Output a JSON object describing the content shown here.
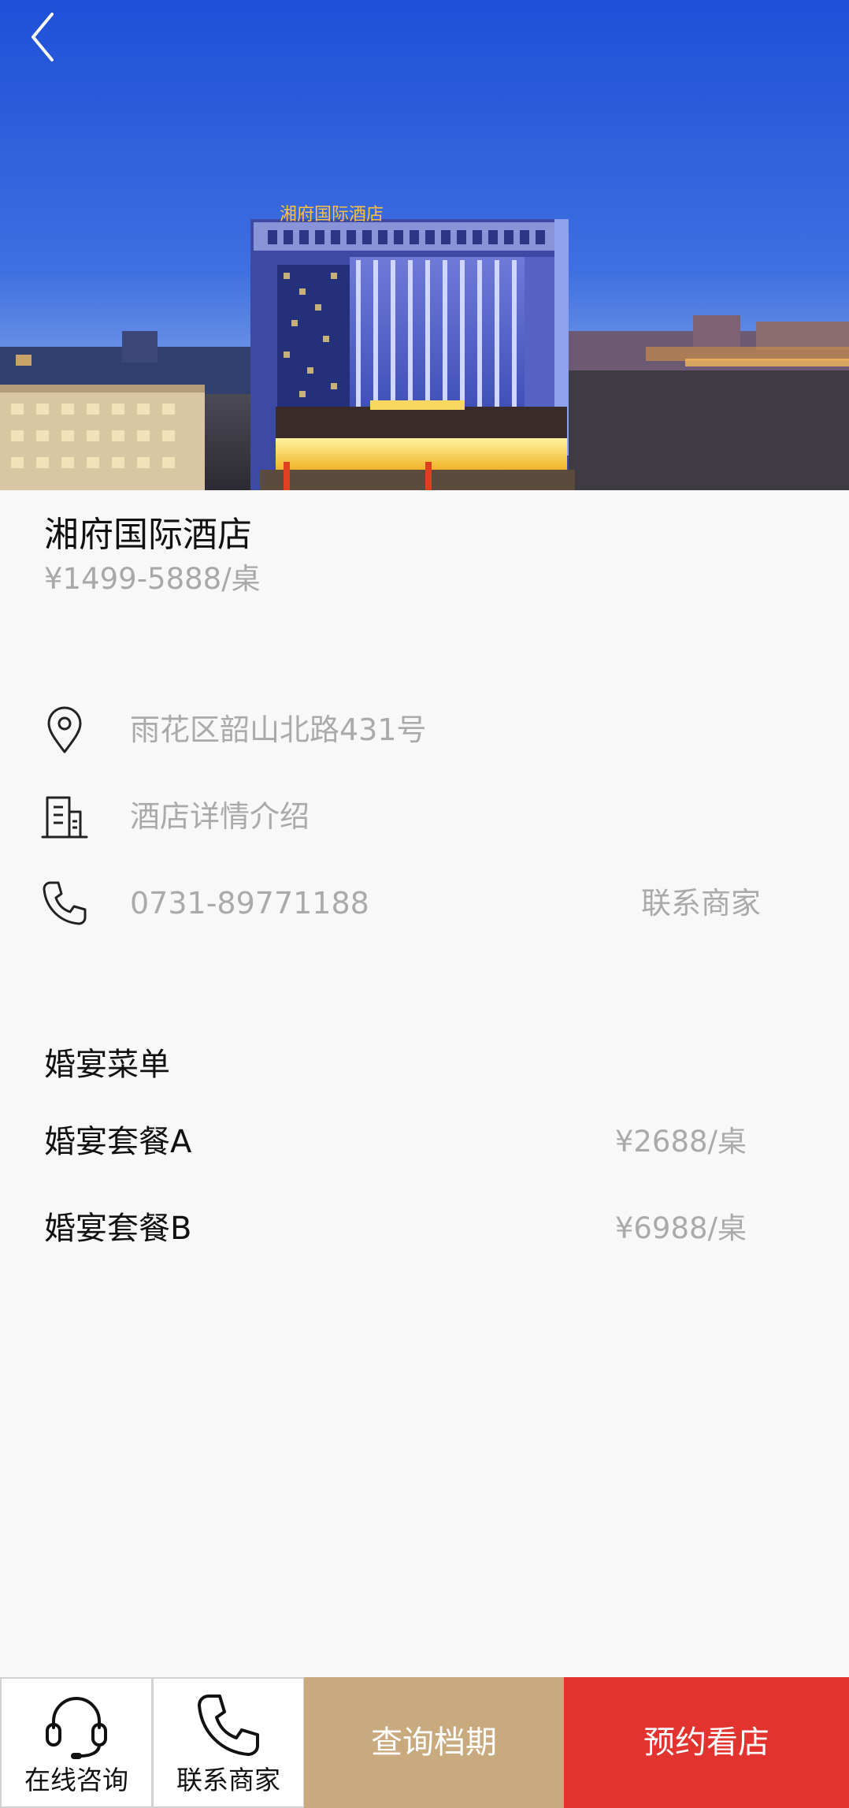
{
  "colors": {
    "page_background": "#f8f8f8",
    "query_button": "#c9aa7e",
    "reserve_button": "#e3332f",
    "primary_text": "#111111",
    "secondary_text": "#aaaaaa"
  },
  "hero": {
    "image": "night-photo-of-hotel-building",
    "sign_text": "湘府国际酒店",
    "back_icon": "chevron-left-icon"
  },
  "venue": {
    "name": "湘府国际酒店",
    "price_range": "¥1499-5888/桌"
  },
  "info": {
    "address": {
      "icon": "location-pin-icon",
      "text": "雨花区韶山北路431号"
    },
    "details": {
      "icon": "building-icon",
      "text": "酒店详情介绍"
    },
    "phone": {
      "icon": "phone-icon",
      "text": "0731-89771188",
      "action": "联系商家"
    }
  },
  "menu": {
    "title": "婚宴菜单",
    "items": [
      {
        "name": "婚宴套餐A",
        "price": "¥2688/桌"
      },
      {
        "name": "婚宴套餐B",
        "price": "¥6988/桌"
      }
    ]
  },
  "bottom_bar": {
    "online_consult": {
      "icon": "headset-icon",
      "label": "在线咨询"
    },
    "contact_merchant": {
      "icon": "phone-icon",
      "label": "联系商家"
    },
    "query_schedule": {
      "label": "查询档期"
    },
    "reserve_visit": {
      "label": "预约看店"
    }
  }
}
